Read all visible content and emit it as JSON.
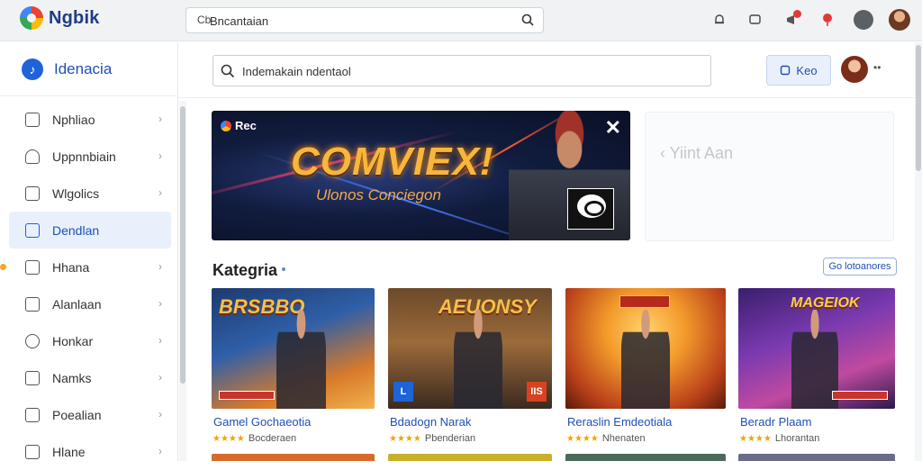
{
  "topbar": {
    "brand": "Ngbik",
    "search_prefix": "Cb",
    "search_value": "Bncantaian",
    "icons": [
      "bell-icon",
      "chat-icon",
      "notification-icon",
      "alert-icon",
      "account-icon",
      "avatar"
    ]
  },
  "sidebar": {
    "title": "Idenacia",
    "items": [
      {
        "label": "Nphliao",
        "icon": "folder-icon"
      },
      {
        "label": "Uppnnbiain",
        "icon": "user-icon"
      },
      {
        "label": "Wlgolics",
        "icon": "folder-icon"
      },
      {
        "label": "Dendlan",
        "icon": "bookmark-icon",
        "active": true
      },
      {
        "label": "Hhana",
        "icon": "chart-icon",
        "marker": true
      },
      {
        "label": "Alanlaan",
        "icon": "image-icon"
      },
      {
        "label": "Honkar",
        "icon": "circle-icon"
      },
      {
        "label": "Namks",
        "icon": "tag-icon"
      },
      {
        "label": "Poealian",
        "icon": "box-icon"
      },
      {
        "label": "Hlane",
        "icon": "chart-icon"
      }
    ]
  },
  "header": {
    "search_value": "Indemakain ndentaol",
    "button_label": "Keo"
  },
  "banner": {
    "tag": "Rec",
    "title": "COMVIEX!",
    "subtitle": "Ulonos Conciegon"
  },
  "promo": {
    "text": "Yiint Aan"
  },
  "section": {
    "title": "Kategria",
    "see_all": "Go lotoanores"
  },
  "games": [
    {
      "title": "Gamel Gochaeotia",
      "subtitle": "Bocderaen",
      "stars": "★★★★",
      "logo": "BRSBBO",
      "badge": ""
    },
    {
      "title": "Bdadogn Narak",
      "subtitle": "Pbenderian",
      "stars": "★★★★",
      "logo": "AEUONSY",
      "badge": "IIS"
    },
    {
      "title": "Reraslin Emdeotiala",
      "subtitle": "Nhenaten",
      "stars": "★★★★",
      "logo": "",
      "badge": ""
    },
    {
      "title": "Beradr Plaam",
      "subtitle": "Lhorantan",
      "stars": "★★★★",
      "logo": "MAGEIOK",
      "badge": ""
    }
  ],
  "colors": {
    "accent": "#1f4fb3",
    "active_bg": "#e8f0fc",
    "star": "#f0a400"
  }
}
